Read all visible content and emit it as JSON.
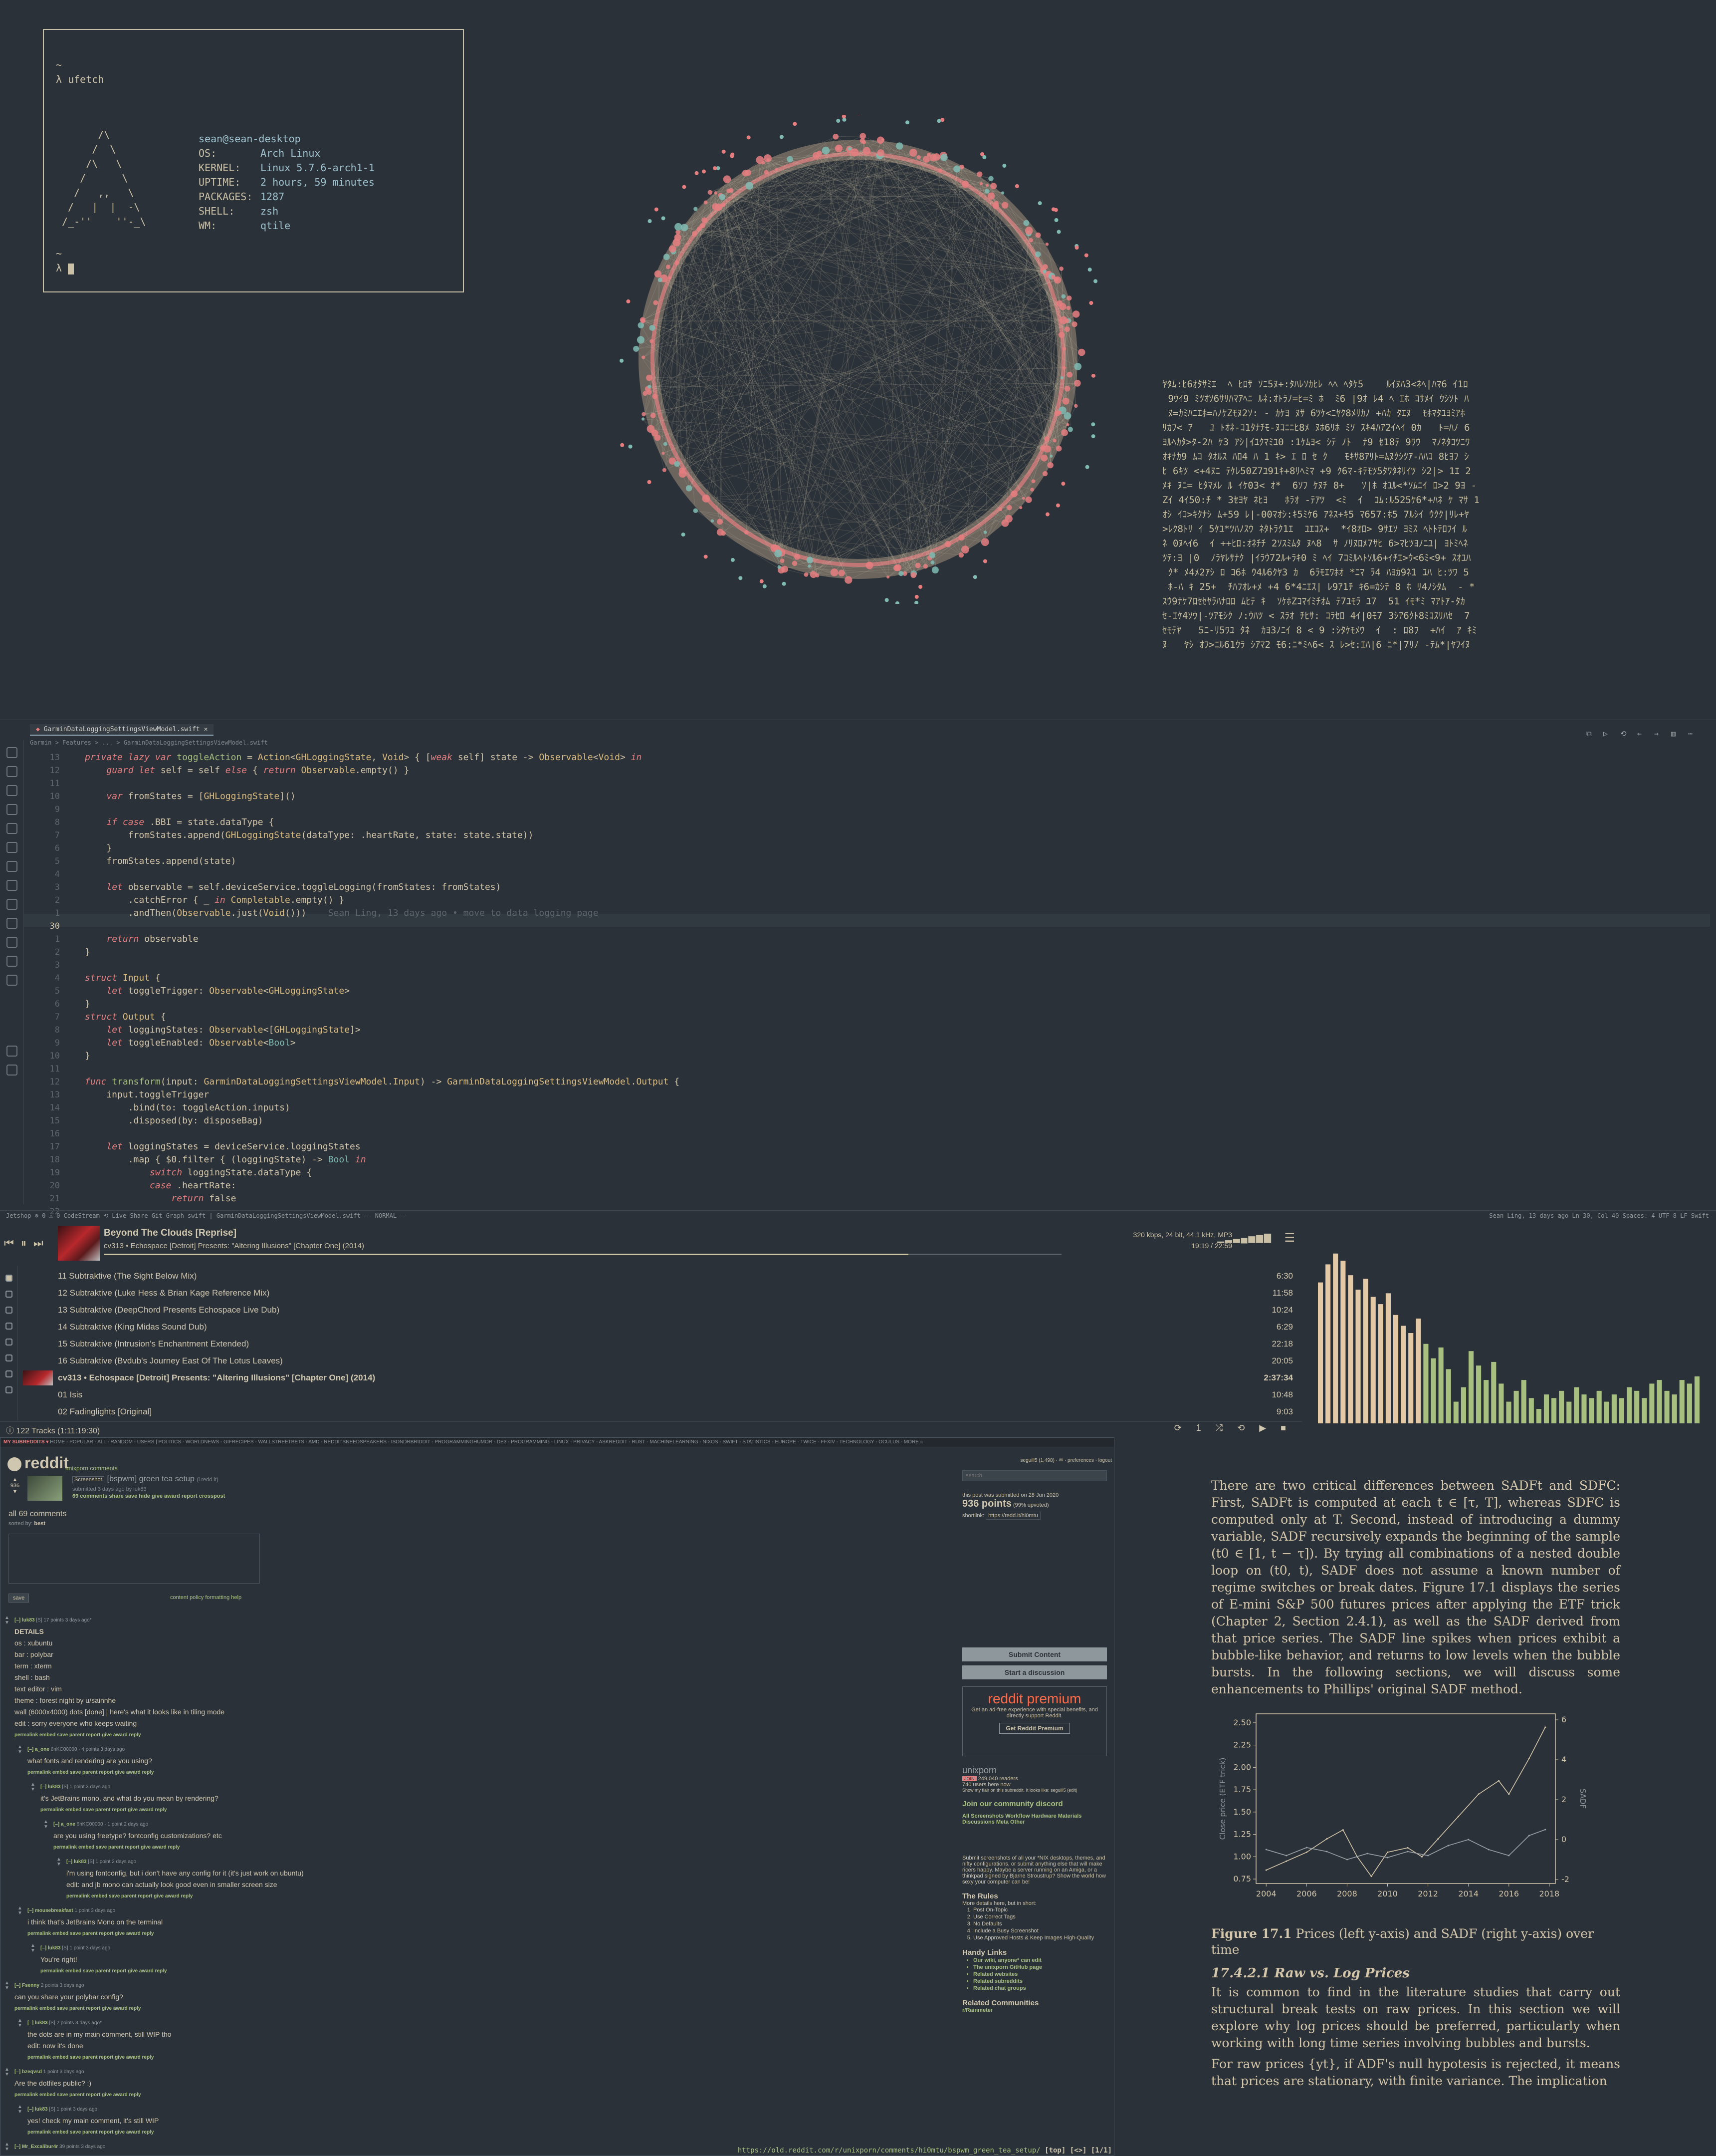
{
  "terminal": {
    "lines": [
      "~",
      "λ ufetch"
    ],
    "logo": "      /\\\n     /  \\\n    /\\   \\\n   /      \\\n  /   ,,   \\\n /   |  |  -\\\n/_-''    ''-_\\",
    "user": "sean@sean-desktop",
    "fields": [
      {
        "k": "OS:",
        "v": "Arch Linux"
      },
      {
        "k": "KERNEL:",
        "v": "Linux 5.7.6-arch1-1"
      },
      {
        "k": "UPTIME:",
        "v": "2 hours, 59 minutes"
      },
      {
        "k": "PACKAGES:",
        "v": "1287"
      },
      {
        "k": "SHELL:",
        "v": "zsh"
      },
      {
        "k": "WM:",
        "v": "qtile"
      }
    ],
    "prompt_tilde": "~",
    "prompt": "λ"
  },
  "ide": {
    "tab": "GarminDataLoggingSettingsViewModel.swift",
    "breadcrumb": "Garmin > Features > ... > GarminDataLoggingSettingsViewModel.swift",
    "line_numbers": [
      "13",
      "12",
      "11",
      "10",
      "9",
      "8",
      "7",
      "6",
      "5",
      "4",
      "3",
      "2",
      "1",
      "30",
      "1",
      "2",
      "3",
      "4",
      "5",
      "6",
      "7",
      "8",
      "9",
      "10",
      "11",
      "12",
      "13",
      "14",
      "15",
      "16",
      "17",
      "18",
      "19",
      "20",
      "21",
      "22"
    ],
    "blame": "Sean Ling, 13 days ago • move to data logging page",
    "status_left": "Jetshop   ⊗ 0 ⚠ 0   CodeStream   ⟲ Live Share   Git Graph   swift | GarminDataLoggingSettingsViewModel.swift   -- NORMAL --",
    "status_right": "Sean Ling, 13 days ago   Ln 30, Col 40   Spaces: 4   UTF-8   LF   Swift"
  },
  "player": {
    "now_title": "Beyond The Clouds [Reprise]",
    "now_sub": "cv313 • Echospace [Detroit] Presents: \"Altering Illusions\" [Chapter One] (2014)",
    "meta": "320 kbps, 24 bit, 44.1 kHz, MP3",
    "time": "19:19 / 22:59",
    "progress": 0.84,
    "tracks": [
      {
        "t": "11 Subtraktive (The Sight Below Mix)",
        "d": "6:30",
        "album": false
      },
      {
        "t": "12 Subtraktive (Luke Hess & Brian Kage Reference Mix)",
        "d": "11:58",
        "album": false
      },
      {
        "t": "13 Subtraktive (DeepChord Presents Echospace Live Dub)",
        "d": "10:24",
        "album": false
      },
      {
        "t": "14 Subtraktive (King Midas Sound Dub)",
        "d": "6:29",
        "album": false
      },
      {
        "t": "15 Subtraktive (Intrusion's Enchantment Extended)",
        "d": "22:18",
        "album": false
      },
      {
        "t": "16 Subtraktive (Bvdub's Journey East Of The Lotus Leaves)",
        "d": "20:05",
        "album": false
      },
      {
        "t": "cv313 • Echospace [Detroit] Presents: \"Altering Illusions\" [Chapter One] (2014)",
        "d": "2:37:34",
        "album": true
      },
      {
        "t": "01 Isis",
        "d": "10:48",
        "album": false
      },
      {
        "t": "02 Fadinglights [Original]",
        "d": "9:03",
        "album": false
      }
    ],
    "footer": "122 Tracks (1:11:19:30)",
    "foot_controls": "⟳ 1 ⤮ ⟲ ▶ ■"
  },
  "viz": {
    "levels": [
      0.78,
      0.88,
      0.94,
      0.9,
      0.82,
      0.74,
      0.8,
      0.7,
      0.66,
      0.72,
      0.6,
      0.54,
      0.5,
      0.58,
      0.44,
      0.36,
      0.42,
      0.3,
      0.12,
      0.2,
      0.4,
      0.32,
      0.24,
      0.34,
      0.22,
      0.12,
      0.18,
      0.24,
      0.14,
      0.08,
      0.16,
      0.14,
      0.18,
      0.12,
      0.2,
      0.16,
      0.14,
      0.18,
      0.12,
      0.16,
      0.14,
      0.2,
      0.18,
      0.14,
      0.22,
      0.24,
      0.18,
      0.16,
      0.24,
      0.22,
      0.26
    ],
    "color_high": "#e3c9a6",
    "color_low": "#a7c080"
  },
  "reddit": {
    "topbar_sub": "MY SUBREDDITS ▾",
    "topbar": "HOME - POPULAR - ALL - RANDOM - USERS | POLITICS - WORLDNEWS - GIFRECIPES - WALLSTREETBETS - AMD - REDDITSNEEDSPEAKERS - ISONDRBRIDDIT - PROGRAMMINGHUMOR - DE3 - PROGRAMMING - LINUX - PRIVACY - ASKREDDIT - RUST - MACHINELEARNING - NIXOS - SWIFT - STATISTICS - EUROPE - TWICE - FFXIV - TECHNOLOGY - OCULUS - MORE »",
    "logo": "reddit",
    "subtabs": "unixporn   comments",
    "score": "936",
    "flair": "Screenshot",
    "title": "[bspwm] green tea setup",
    "domain": "(i.redd.it)",
    "submitted": "submitted 3 days ago by luk83",
    "ncomments": "69 comments",
    "actions": "share  save  hide  give award  report  crosspost",
    "all_comments": "all 69 comments",
    "sorted_label": "sorted by:",
    "sorted_value": "best",
    "save": "save",
    "policy": "content policy   formatting help",
    "comments": [
      {
        "depth": 0,
        "head": "[–] luk83",
        "meta": "[S] 17 points 3 days ago*",
        "body": [
          "DETAILS",
          "os : xubuntu",
          "bar : polybar",
          "term : xterm",
          "shell : bash",
          "text editor : vim",
          "theme : forest night by u/sainnhe",
          "wall (6000x4000) dots [done] | here's what it looks like in tiling mode",
          "edit : sorry everyone who keeps waiting"
        ]
      },
      {
        "depth": 1,
        "head": "[–] a_one",
        "meta": "6nKC00000 · 4 points 3 days ago",
        "body": [
          "what fonts and rendering are you using?"
        ]
      },
      {
        "depth": 2,
        "head": "[–] luk83",
        "meta": "[S] 1 point 3 days ago",
        "body": [
          "it's JetBrains mono, and what do you mean by rendering?"
        ]
      },
      {
        "depth": 3,
        "head": "[–] a_one",
        "meta": "6nKC00000 · 1 point 2 days ago",
        "body": [
          "are you using freetype? fontconfig customizations? etc"
        ]
      },
      {
        "depth": 4,
        "head": "[–] luk83",
        "meta": "[S] 1 point 2 days ago",
        "body": [
          "i'm using fontconfig, but i don't have any config for it (it's just work on ubuntu)",
          "edit: and jb mono can actually look good even in smaller screen size"
        ]
      },
      {
        "depth": 1,
        "head": "[–] mousebreakfast",
        "meta": "1 point 3 days ago",
        "body": [
          "i think that's JetBrains Mono on the terminal"
        ]
      },
      {
        "depth": 2,
        "head": "[–] luk83",
        "meta": "[S] 1 point 3 days ago",
        "body": [
          "You're right!"
        ]
      },
      {
        "depth": 0,
        "head": "[–] Fsenny",
        "meta": "2 points 3 days ago",
        "body": [
          "can you share your polybar config?"
        ]
      },
      {
        "depth": 1,
        "head": "[–] luk83",
        "meta": "[S] 2 points 3 days ago*",
        "body": [
          "the dots are in my main comment, still WIP tho",
          "edit: now it's done"
        ]
      },
      {
        "depth": 0,
        "head": "[–] bzeqvsd",
        "meta": "1 point 3 days ago",
        "body": [
          "Are the dotfiles public? :)"
        ]
      },
      {
        "depth": 1,
        "head": "[–] luk83",
        "meta": "[S] 1 point 3 days ago",
        "body": [
          "yes! check my main comment, it's still WIP"
        ]
      },
      {
        "depth": 0,
        "head": "[–] Mr_Excalibur4r",
        "meta": "39 points 3 days ago",
        "body": [
          "very noice, my body temperature goes down just by looking at this rice.",
          "What is the name of this theme? and how do you have the too bar on vim? is that lightline?"
        ]
      }
    ],
    "actions_line": "permalink  embed  save  parent  report  give award  reply",
    "sidebar": {
      "user": "seguill5 (1,498) · ✉ · preferences · logout",
      "search": "search",
      "submitted_on": "this post was submitted on 28 Jun 2020",
      "points": "936 points",
      "upvoted": "(99% upvoted)",
      "shortlink_label": "shortlink:",
      "shortlink": "https://redd.it/hi0mtu",
      "submit_content": "Submit Content",
      "start_discussion": "Start a discussion",
      "premium_title": "reddit premium",
      "premium_text": "Get an ad-free experience with special benefits, and directly support Reddit.",
      "premium_btn": "Get Reddit Premium",
      "sub_name": "unixporn",
      "readers": "249,040 readers",
      "online": "740 users here now",
      "flair_note": "Show my flair on this subreddit. It looks like: seguill5 (edit)",
      "discord": "Join our community discord",
      "links": "All Screenshots Workflow Hardware Materials Discussions Meta Other",
      "about": "Submit screenshots of all your *NIX desktops, themes, and nifty configurations, or submit anything else that will make ricers happy. Maybe a server running on an Amiga, or a thinkpad signed by Bjarne Stroustrup? Show the world how sexy your computer can be!",
      "rules_title": "The Rules",
      "rules_intro": "More details here, but in short:",
      "rules": [
        "Post On-Topic",
        "Use Correct Tags",
        "No Defaults",
        "Include a Busy Screenshot",
        "Use Approved Hosts & Keep Images High-Quality"
      ],
      "handy_title": "Handy Links",
      "handy": [
        "Our wiki, anyone* can edit",
        "The unixporn GitHub page",
        "Related websites",
        "Related subreddits",
        "Related chat groups"
      ],
      "related_title": "Related Communities",
      "related": "r/Rainmeter"
    },
    "url": "https://old.reddit.com/r/unixporn/comments/hi0mtu/bspwm_green_tea_setup/",
    "url_tail": "[top] [<>] [1/1]"
  },
  "doc": {
    "para1": "There are two critical differences between SADFt and SDFC: First, SADFt is computed at each t ∈ [τ, T], whereas SDFC is computed only at T. Second, instead of introducing a dummy variable, SADF recursively expands the beginning of the sample (t0 ∈ [1, t − τ]). By trying all combinations of a nested double loop on (t0, t), SADF does not assume a known number of regime switches or break dates. Figure 17.1 displays the series of E-mini S&P 500 futures prices after applying the ETF trick (Chapter 2, Section 2.4.1), as well as the SADF derived from that price series. The SADF line spikes when prices exhibit a bubble-like behavior, and returns to low levels when the bubble bursts. In the following sections, we will discuss some enhancements to Phillips' original SADF method.",
    "fig_label": "Figure 17.1",
    "fig_caption": "Prices (left y-axis) and SADF (right y-axis) over time",
    "section": "17.4.2.1 Raw vs. Log Prices",
    "para2": "It is common to find in the literature studies that carry out structural break tests on raw prices. In this section we will explore why log prices should be preferred, particularly when working with long time series involving bubbles and bursts.",
    "para3": "For raw prices {yt}, if ADF's null hypotesis is rejected, it means that prices are stationary, with finite variance. The implication"
  },
  "chart_data": {
    "type": "line",
    "title": "",
    "xlabel": "",
    "ylabel": "Close price (ETF trick)",
    "y2label": "SADF",
    "xlim": [
      2003.5,
      2018.3
    ],
    "ylim": [
      0.7,
      2.6
    ],
    "y2lim": [
      -2.2,
      6.3
    ],
    "xticks": [
      "2004",
      "2006",
      "2008",
      "2010",
      "2012",
      "2014",
      "2016",
      "2018"
    ],
    "yticks": [
      "0.75",
      "1.00",
      "1.25",
      "1.50",
      "1.75",
      "2.00",
      "2.25",
      "2.50"
    ],
    "y2ticks": [
      "-2",
      "0",
      "2",
      "4",
      "6"
    ],
    "series": [
      {
        "axis": "left",
        "x": [
          2004,
          2005,
          2006,
          2007,
          2007.8,
          2008.5,
          2009.2,
          2010,
          2011,
          2011.7,
          2012.5,
          2013.5,
          2014.5,
          2015.5,
          2016,
          2017,
          2017.8
        ],
        "values": [
          0.85,
          0.95,
          1.05,
          1.2,
          1.3,
          1.0,
          0.78,
          1.05,
          1.1,
          1.0,
          1.2,
          1.45,
          1.7,
          1.85,
          1.7,
          2.1,
          2.45
        ]
      },
      {
        "axis": "right",
        "x": [
          2004,
          2005,
          2006,
          2007,
          2008,
          2009,
          2010,
          2011,
          2012,
          2013,
          2014,
          2015,
          2016,
          2017,
          2017.8
        ],
        "values": [
          -0.5,
          -0.8,
          -0.4,
          -0.6,
          -1.0,
          -0.7,
          -0.9,
          -0.6,
          -0.8,
          -0.3,
          0.0,
          -0.5,
          -0.8,
          0.2,
          0.5
        ]
      }
    ]
  }
}
